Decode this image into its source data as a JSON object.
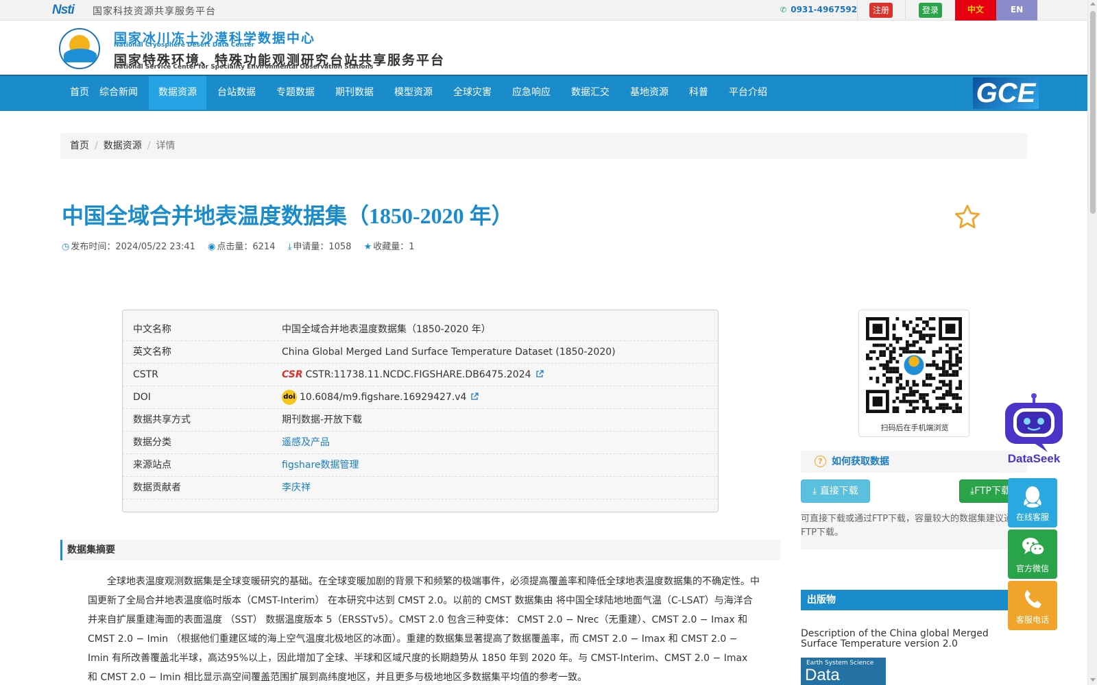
{
  "topbar": {
    "logo_text": "Nsti",
    "platform_name": "国家科技资源共享服务平台",
    "phone": "0931-4967592",
    "register": "注册",
    "login": "登录",
    "lang_zh": "中文",
    "lang_en": "EN"
  },
  "header": {
    "center_cn": "国家冰川冻土沙漠科学数据中心",
    "center_en": "National Cryosphere Desert Data Center",
    "station_cn": "国家特殊环境、特殊功能观测研究台站共享服务平台",
    "station_en": "National Service Center for Speciality Environmental Observation Stations"
  },
  "nav": {
    "items": [
      {
        "label": "首页"
      },
      {
        "label": "综合新闻"
      },
      {
        "label": "数据资源"
      },
      {
        "label": "台站数据"
      },
      {
        "label": "专题数据"
      },
      {
        "label": "期刊数据"
      },
      {
        "label": "模型资源"
      },
      {
        "label": "全球灾害"
      },
      {
        "label": "应急响应"
      },
      {
        "label": "数据汇交"
      },
      {
        "label": "基地资源"
      },
      {
        "label": "科普"
      },
      {
        "label": "平台介绍"
      }
    ],
    "active_index": 2,
    "gce_logo": "GCE"
  },
  "breadcrumb": {
    "home": "首页",
    "section": "数据资源",
    "current": "详情"
  },
  "dataset": {
    "title": "中国全域合并地表温度数据集（1850-2020 年）",
    "publish_label": "发布时间：",
    "publish_time": "2024/05/22 23:41",
    "views_label": "点击量：",
    "views": "6214",
    "requests_label": "申请量：",
    "requests": "1058",
    "favorites_label": "收藏量：",
    "favorites": "1"
  },
  "info": {
    "cn_name_label": "中文名称",
    "cn_name": "中国全域合并地表温度数据集（1850-2020 年）",
    "en_name_label": "英文名称",
    "en_name": "China Global Merged Land Surface Temperature Dataset (1850-2020)",
    "cstr_label": "CSTR",
    "cstr_badge": "CSR",
    "cstr": "CSTR:11738.11.NCDC.FIGSHARE.DB6475.2024",
    "doi_label": "DOI",
    "doi_badge": "doi",
    "doi": "10.6084/m9.figshare.16929427.v4",
    "share_label": "数据共享方式",
    "share": "期刊数据-开放下载",
    "category_label": "数据分类",
    "category": "遥感及产品",
    "source_label": "来源站点",
    "source": "figshare数据管理",
    "contributor_label": "数据贡献者",
    "contributor": "李庆祥"
  },
  "abstract": {
    "heading": "数据集摘要",
    "text": "全球地表温度观测数据集是全球变暖研究的基础。在全球变暖加剧的背景下和频繁的极端事件，必须提高覆盖率和降低全球地表温度数据集的不确定性。中国更新了全局合并地表温度临时版本（CMST-Interim） 在本研究中达到 CMST 2.0。以前的 CMST 数据集由 将中国全球陆地地面气温（C-LSAT）与海洋合并来自扩展重建海面的表面温度 （SST） 数据温度版本 5（ERSSTv5）。CMST 2.0 包含三种变体： CMST 2.0 − Nrec（无重建）、CMST 2.0 − Imax 和 CMST 2.0 − Imin （根据他们重建区域的海上空气温度北极地区的冰面）。重建的数据集显著提高了数据覆盖率，而 CMST 2.0 − Imax 和 CMST 2.0 − Imin 有所改善覆盖北半球，高达95%以上，因此增加了全球、半球和区域尺度的长期趋势从 1850 年到 2020 年。与 CMST-Interim、CMST 2.0 − Imax 和 CMST 2.0 − Imin 相比显示高空间覆盖范围扩展到高纬度地区，并且更多与极地地区多数据集平均值的参考一致。"
  },
  "sidebar": {
    "qr_caption": "扫码后在手机端浏览",
    "how_heading": "如何获取数据",
    "direct_download": "直接下载",
    "ftp_download": "FTP下载",
    "note": "可直接下载或通过FTP下载，容量较大的数据集建议通过FTP下载。",
    "pub_heading": "出版物",
    "pub_title": "Description of the China global Merged Surface Temperature version 2.0",
    "essd_small": "Earth System Science",
    "essd_big": "Data"
  },
  "floating": {
    "dataseek": "DataSeek",
    "online_service": "在线客服",
    "wechat": "官方微信",
    "phone": "客服电话"
  },
  "colors": {
    "brand_blue": "#1a8ccc",
    "nav_active": "#26a3e4",
    "register_red": "#d9332b",
    "login_green": "#2aa44a"
  }
}
